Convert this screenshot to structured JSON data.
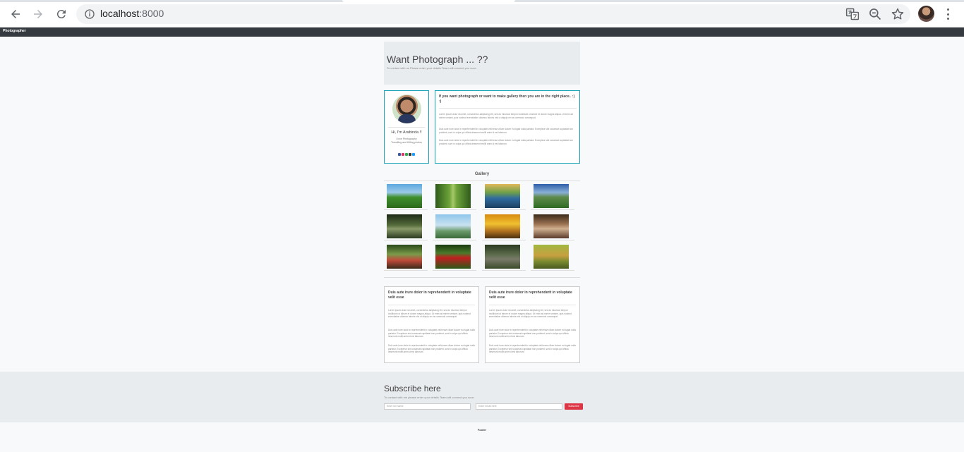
{
  "browser": {
    "url_host": "localhost",
    "url_port": ":8000"
  },
  "navbar": {
    "brand": "Photographer"
  },
  "jumbotron": {
    "heading": "Want Photograph ... ??",
    "subtext": "To contact with us Please enter your details Team will connect you soon"
  },
  "profile": {
    "name": "Hi, I'm Arabinda !!",
    "tagline_1": "I love Photography",
    "tagline_2": "Travelling and Hilling photos",
    "social_icons": [
      "facebook-icon",
      "instagram-icon",
      "google-icon",
      "github-icon",
      "twitter-icon"
    ],
    "social_colors": [
      "#3b5998",
      "#e1306c",
      "#34a853",
      "#333333",
      "#1da1f2"
    ]
  },
  "about": {
    "title": "If you want photograph or want to make gallery then you are in the right place.. :) :)",
    "para_1": "Lorem ipsum dolor sit amet, consectetur adipiscing elit, sed do eiusmod tempor incididunt ut labore et dolore magna aliqua. Ut enim ad minim veniam, quis nostrud exercitation ullamco laboris nisi ut aliquip ex ea commodo consequat.",
    "para_2": "Duis aute irure dolor in reprehenderit in voluptate velit esse cillum dolore eu fugiat nulla pariatur. Excepteur sint occaecat cupidatat non proident, sunt in culpa qui officia deserunt mollit anim id est laborum.",
    "para_3": "Duis aute irure dolor in reprehenderit in voluptate velit esse cillum dolore eu fugiat nulla pariatur. Excepteur sint occaecat cupidatat non proident, sunt in culpa qui officia deserunt mollit anim id est laborum."
  },
  "gallery": {
    "title": "Gallery",
    "photos": [
      "green-field-tree",
      "forest-path",
      "lake-mountains",
      "mountain-valley",
      "bridge-trees",
      "person-hills",
      "yellow-flowers-animal",
      "pets-garden",
      "bus-forest",
      "red-bird",
      "elephant-forest",
      "giraffe-grassland"
    ],
    "photo_gradients": [
      "linear-gradient(180deg,#5da9e0 0%,#9cc9e8 35%,#3f8f2c 55%,#2c6a1c 100%)",
      "linear-gradient(90deg,#2e5a1a 0%,#6ea43a 40%,#a8c86a 50%,#6ea43a 60%,#2e5a1a 100%)",
      "linear-gradient(180deg,#e0b85a 0%,#6fa04a 35%,#2f6aa0 60%,#1d4060 100%)",
      "linear-gradient(180deg,#2c5ea8 0%,#8ab0d8 35%,#5e8a4a 55%,#2e6a24 100%)",
      "linear-gradient(180deg,#1c2a18 0%,#556b3a 45%,#8a9a6a 60%,#2a3a20 100%)",
      "linear-gradient(180deg,#8fc6ea 0%,#c9e2f1 45%,#6a9a6a 70%,#3a6a3a 100%)",
      "linear-gradient(180deg,#d88a10 0%,#f0c030 40%,#b07020 70%,#4a3010 100%)",
      "linear-gradient(180deg,#3a2a1a 0%,#9a7050 40%,#d0b090 60%,#5a3a2a 100%)",
      "linear-gradient(180deg,#2a4a1a 0%,#7a9a4a 40%,#c04a3a 65%,#3a2a1a 100%)",
      "linear-gradient(180deg,#1a3a10 0%,#4a7a2a 35%,#c02020 55%,#2a5a18 100%)",
      "linear-gradient(180deg,#2a3a20 0%,#5a6a4a 40%,#7a7a6a 60%,#3a4a2a 100%)",
      "linear-gradient(180deg,#a0b840 0%,#c8a040 45%,#7a8a30 70%,#4a5a20 100%)"
    ]
  },
  "cards": [
    {
      "title": "Duis aute irure dolor in reprehenderit in voluptate velit esse",
      "para_1": "Lorem ipsum dolor sit amet, consectetur adipiscing elit, sed do eiusmod tempor incididunt ut labore et dolore magna aliqua. Ut enim ad minim veniam, quis nostrud exercitation ullamco laboris nisi ut aliquip ex ea commodo consequat.",
      "para_2": "Duis aute irure dolor in reprehenderit in voluptate velit esse cillum dolore eu fugiat nulla pariatur. Excepteur sint occaecat cupidatat non proident, sunt in culpa qui officia deserunt mollit anim id est laborum.",
      "para_3": "Duis aute irure dolor in reprehenderit in voluptate velit esse cillum dolore eu fugiat nulla pariatur. Excepteur sint occaecat cupidatat non proident, sunt in culpa qui officia deserunt mollit anim id est laborum."
    },
    {
      "title": "Duis aute irure dolor in reprehenderit in voluptate velit esse",
      "para_1": "Lorem ipsum dolor sit amet, consectetur adipiscing elit, sed do eiusmod tempor incididunt ut labore et dolore magna aliqua. Ut enim ad minim veniam, quis nostrud exercitation ullamco laboris nisi ut aliquip ex ea commodo consequat.",
      "para_2": "Duis aute irure dolor in reprehenderit in voluptate velit esse cillum dolore eu fugiat nulla pariatur. Excepteur sint occaecat cupidatat non proident, sunt in culpa qui officia deserunt mollit anim id est laborum.",
      "para_3": "Duis aute irure dolor in reprehenderit in voluptate velit esse cillum dolore eu fugiat nulla pariatur. Excepteur sint occaecat cupidatat non proident, sunt in culpa qui officia deserunt mollit anim id est laborum."
    }
  ],
  "subscribe": {
    "heading": "Subscribe here",
    "note": "To contact with me please enter your details Team will connect you soon",
    "name_placeholder": "Enter full name",
    "email_placeholder": "Enter email here",
    "button_label": "Subscribe",
    "button_color": "#dc3545"
  },
  "footer": {
    "text": "Footer"
  }
}
